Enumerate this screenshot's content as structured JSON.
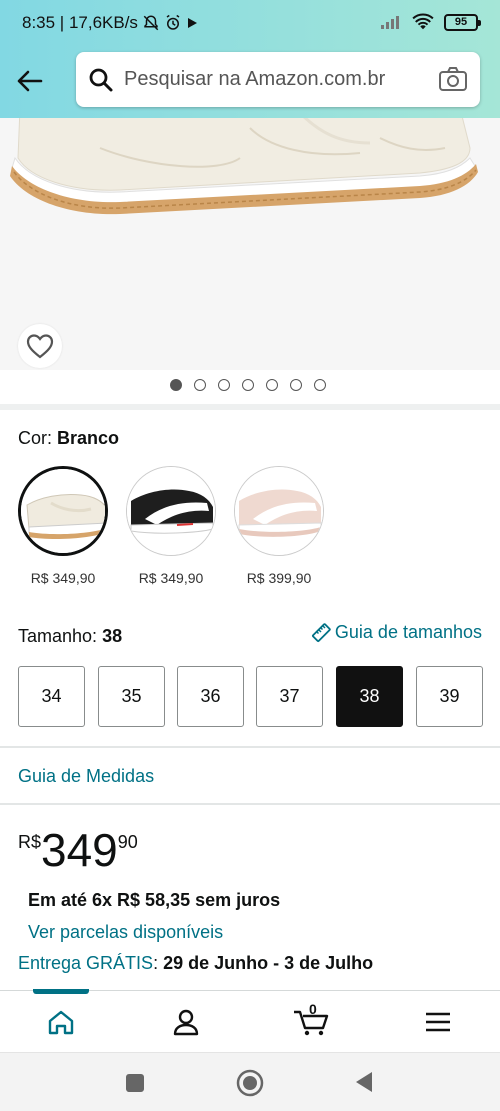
{
  "status_bar": {
    "time_speed": "8:35 | 17,6KB/s",
    "battery": "95"
  },
  "search": {
    "placeholder": "Pesquisar na Amazon.com.br"
  },
  "gallery": {
    "dot_count": 7,
    "active_index": 0
  },
  "color": {
    "label": "Cor: ",
    "value": "Branco",
    "options": [
      {
        "price": "R$ 349,90",
        "variant": "white-gum",
        "selected": true
      },
      {
        "price": "R$ 349,90",
        "variant": "black-white",
        "selected": false
      },
      {
        "price": "R$ 399,90",
        "variant": "pink-white",
        "selected": false
      }
    ]
  },
  "size": {
    "label": "Tamanho: ",
    "value": "38",
    "guide_link": "Guia de tamanhos",
    "options": [
      "34",
      "35",
      "36",
      "37",
      "38",
      "39"
    ],
    "selected": "38"
  },
  "measures_link": "Guia de Medidas",
  "price": {
    "currency": "R$",
    "whole": "349",
    "cents": "90",
    "installments": "Em até 6x R$ 58,35 sem juros",
    "installments_link": "Ver parcelas disponíveis",
    "delivery_prefix": "Entrega GRÁTIS",
    "delivery_sep": ": ",
    "delivery_dates": "29 de Junho - 3 de Julho"
  },
  "bottom_nav": {
    "cart_count": "0"
  },
  "colors": {
    "accent": "#007185",
    "header_start": "#82d8e3",
    "header_end": "#a5e6d7"
  }
}
